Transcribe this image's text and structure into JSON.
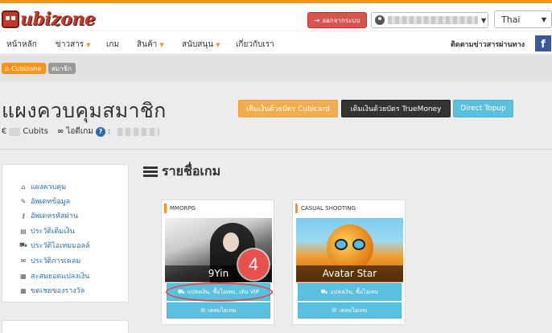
{
  "header": {
    "logo_text": "ubizone",
    "logout_label": "ออกจากระบบ",
    "language": "Thai"
  },
  "nav": {
    "items": [
      {
        "label": "หน้าหลัก",
        "has_dropdown": false
      },
      {
        "label": "ข่าวสาร",
        "has_dropdown": true
      },
      {
        "label": "เกม",
        "has_dropdown": false
      },
      {
        "label": "สินค้า",
        "has_dropdown": true
      },
      {
        "label": "สนับสนุน",
        "has_dropdown": true
      },
      {
        "label": "เกี่ยวกับเรา",
        "has_dropdown": false
      }
    ],
    "follow_label": "ติดตามข่าวสารผ่านทาง",
    "facebook_label": "f"
  },
  "breadcrumb": {
    "home": "Cubizone",
    "current": "สมาชิก"
  },
  "page": {
    "title": "แผงควบคุมสมาชิก",
    "cubits_prefix": "€",
    "cubits_label": "Cubits",
    "game_id_label": "ไอดีเกม",
    "help": "?"
  },
  "topup": {
    "cubicard": "เติมเงินด้วยบัตร Cubicard",
    "truemoney": "เติมเงินด้วยบัตร TrueMoney",
    "direct": "Direct Topup"
  },
  "sidebar": {
    "items": [
      {
        "icon": "home-icon",
        "glyph": "⌂",
        "label": "แผงควบคุม"
      },
      {
        "icon": "edit-icon",
        "glyph": "✎",
        "label": "อัพเดทข้อมูล"
      },
      {
        "icon": "key-icon",
        "glyph": "⚷",
        "label": "อัพเดทรหัสผ่าน"
      },
      {
        "icon": "history-icon",
        "glyph": "▤",
        "label": "ประวัติเติมเงิน"
      },
      {
        "icon": "cart-icon",
        "glyph": "⛟",
        "label": "ประวัติไอเทมมอลล์"
      },
      {
        "icon": "gift-icon",
        "glyph": "✉",
        "label": "ประวัติการเคลม"
      },
      {
        "icon": "calendar-icon",
        "glyph": "▦",
        "label": "สะสมยอดแปลงเงิน"
      },
      {
        "icon": "calendar-icon",
        "glyph": "▦",
        "label": "ขดเชยของรางวัล"
      }
    ]
  },
  "games": {
    "title": "รายชื่อเกม",
    "cards": [
      {
        "genre": "MMORPG",
        "name": "9Yin",
        "btn1": "แปลงเงิน, ซื้อไอเทม, เติม VIP",
        "btn2": "เคลมไอเทม"
      },
      {
        "genre": "CASUAL SHOOTING",
        "name": "Avatar Star",
        "btn1": "แปลงเงิน, ซื้อไอเทม",
        "btn2": "เคลมไอเทม"
      }
    ]
  },
  "annotation": {
    "step": "4"
  }
}
